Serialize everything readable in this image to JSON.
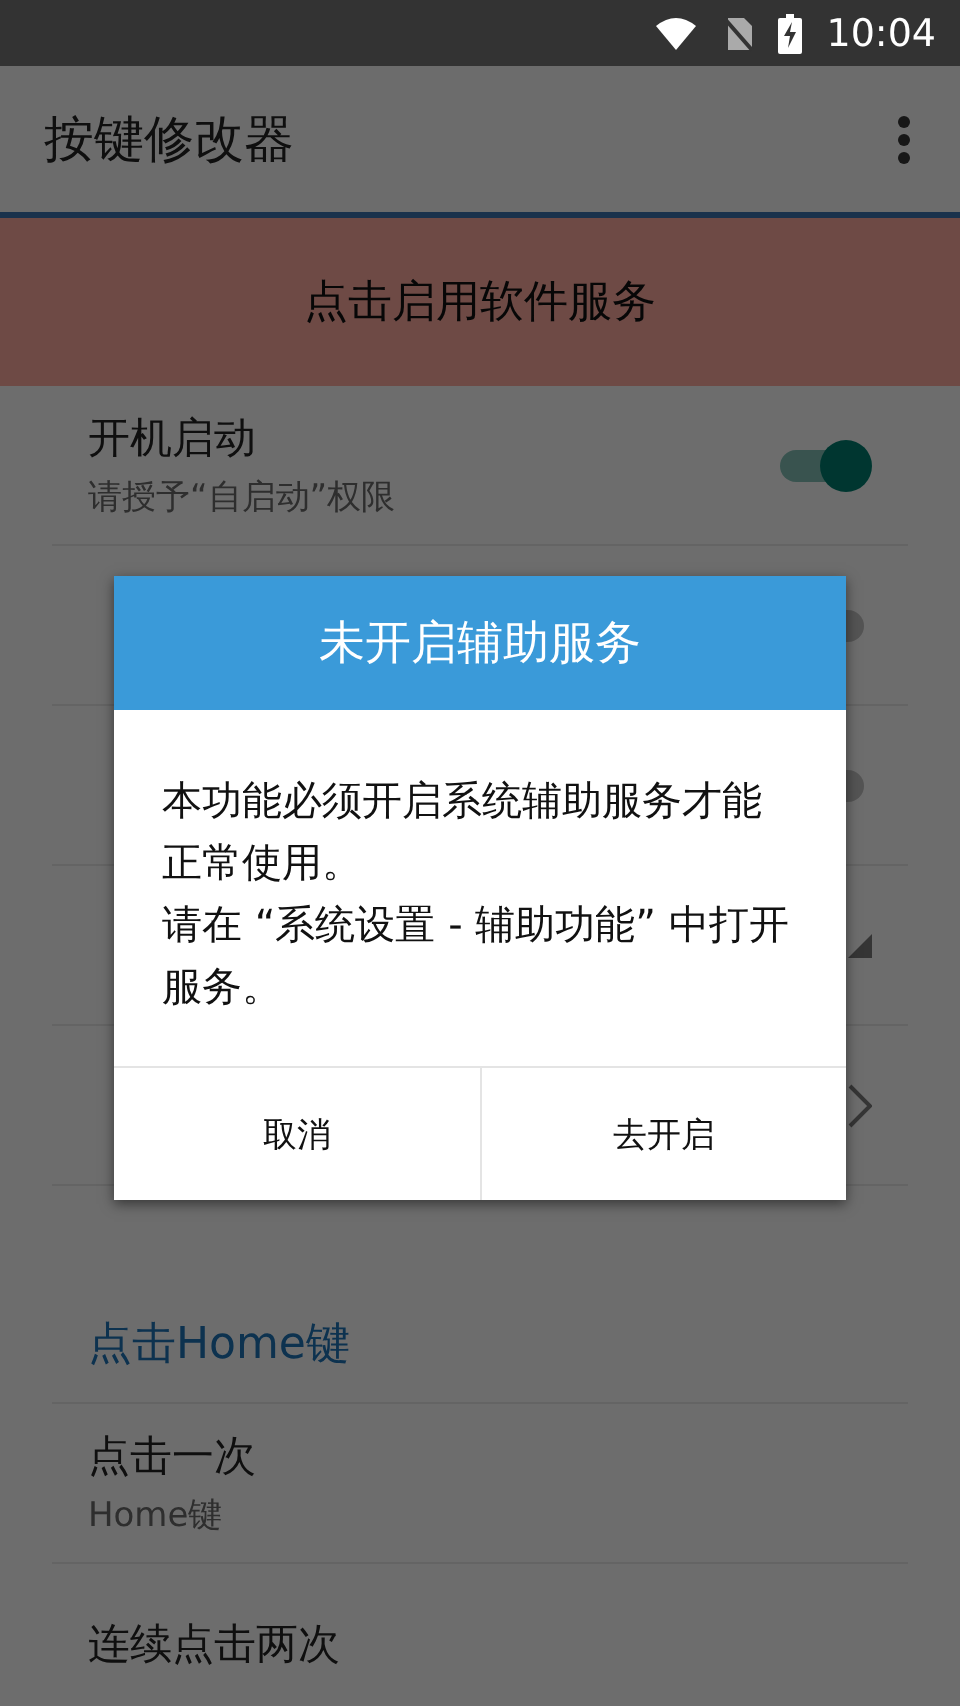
{
  "status_bar": {
    "time": "10:04"
  },
  "app_bar": {
    "title": "按键修改器"
  },
  "banner": {
    "text": "点击启用软件服务"
  },
  "settings": [
    {
      "kind": "switch",
      "title": "开机启动",
      "subtitle": "请授予“自启动”权限",
      "checked": true
    },
    {
      "kind": "switch",
      "checked": false
    },
    {
      "kind": "switch",
      "checked": false
    },
    {
      "kind": "dropdown"
    },
    {
      "kind": "chevron"
    }
  ],
  "section": {
    "title": "点击Home键",
    "items": [
      {
        "title": "点击一次",
        "subtitle": "Home键"
      },
      {
        "title": "连续点击两次"
      }
    ]
  },
  "dialog": {
    "title": "未开启辅助服务",
    "message": [
      "本功能必须开启系统辅助服务才能正常使用。",
      "请在 “系统设置 - 辅助功能” 中打开服务。"
    ],
    "buttons": [
      "取消",
      "去开启"
    ]
  }
}
